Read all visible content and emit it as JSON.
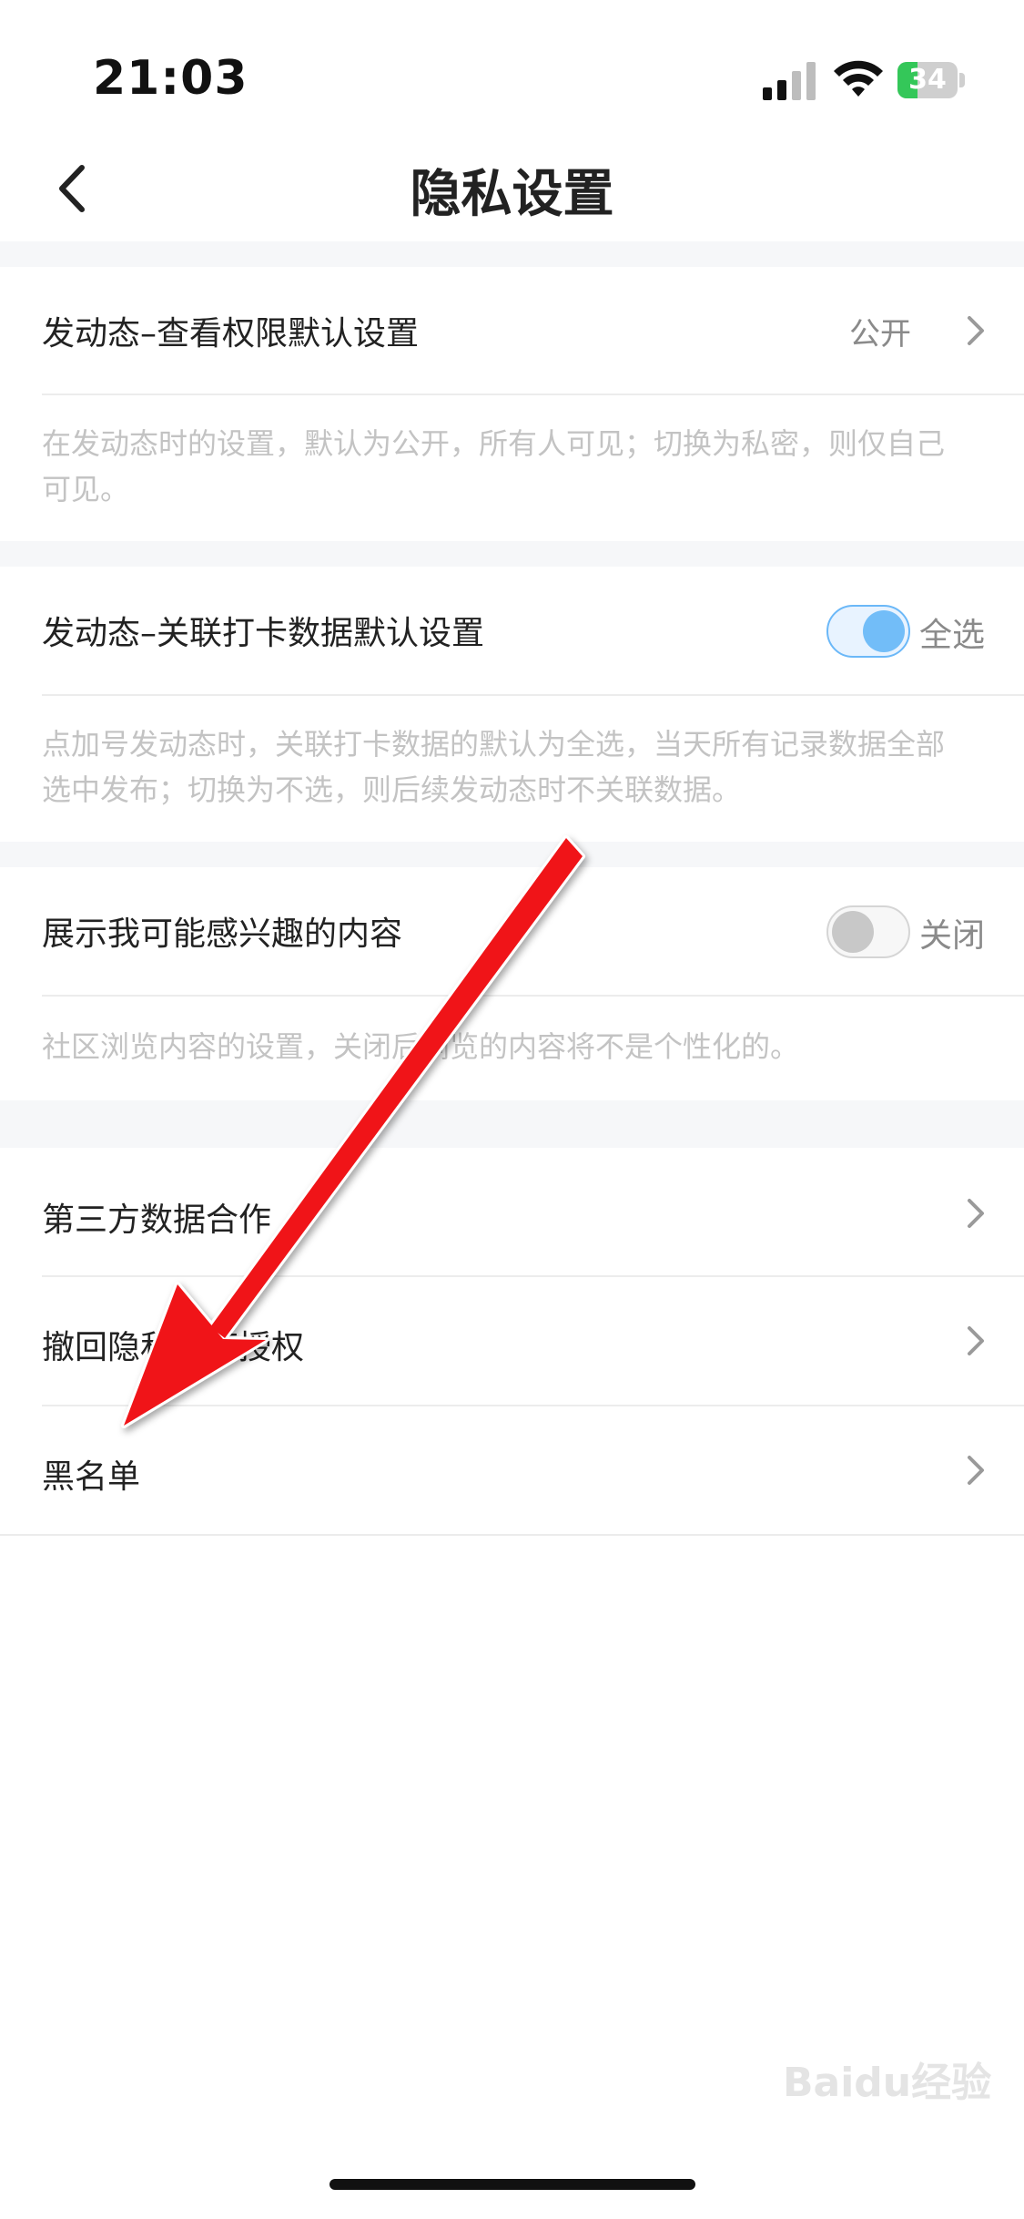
{
  "status_bar": {
    "time": "21:03",
    "battery_level": "34",
    "battery_percent": 34,
    "icons": [
      "signal-icon",
      "wifi-icon",
      "battery-charging-icon"
    ]
  },
  "nav": {
    "title": "隐私设置",
    "back_icon": "chevron-left-icon"
  },
  "sections": {
    "post_visibility": {
      "title": "发动态–查看权限默认设置",
      "value": "公开",
      "desc_line1": "在发动态时的设置，默认为公开，所有人可见；切换为私密，则仅自己",
      "desc_line2": "可见。"
    },
    "post_checkin": {
      "title": "发动态–关联打卡数据默认设置",
      "toggle_on": true,
      "toggle_label": "全选",
      "desc_line1": "点加号发动态时，关联打卡数据的默认为全选，当天所有记录数据全部",
      "desc_line2": "选中发布；切换为不选，则后续发动态时不关联数据。"
    },
    "interest_content": {
      "title": "展示我可能感兴趣的内容",
      "toggle_on": false,
      "toggle_label": "关闭",
      "desc_line1": "社区浏览内容的设置，关闭后浏览的内容将不是个性化的。"
    },
    "links": [
      {
        "label": "第三方数据合作"
      },
      {
        "label": "撤回隐私政策授权"
      },
      {
        "label": "黑名单"
      }
    ]
  },
  "colors": {
    "accent": "#72bdf8",
    "annotation_arrow": "#f01418",
    "section_gap": "#f6f7f9"
  },
  "watermark": "Baidu经验"
}
